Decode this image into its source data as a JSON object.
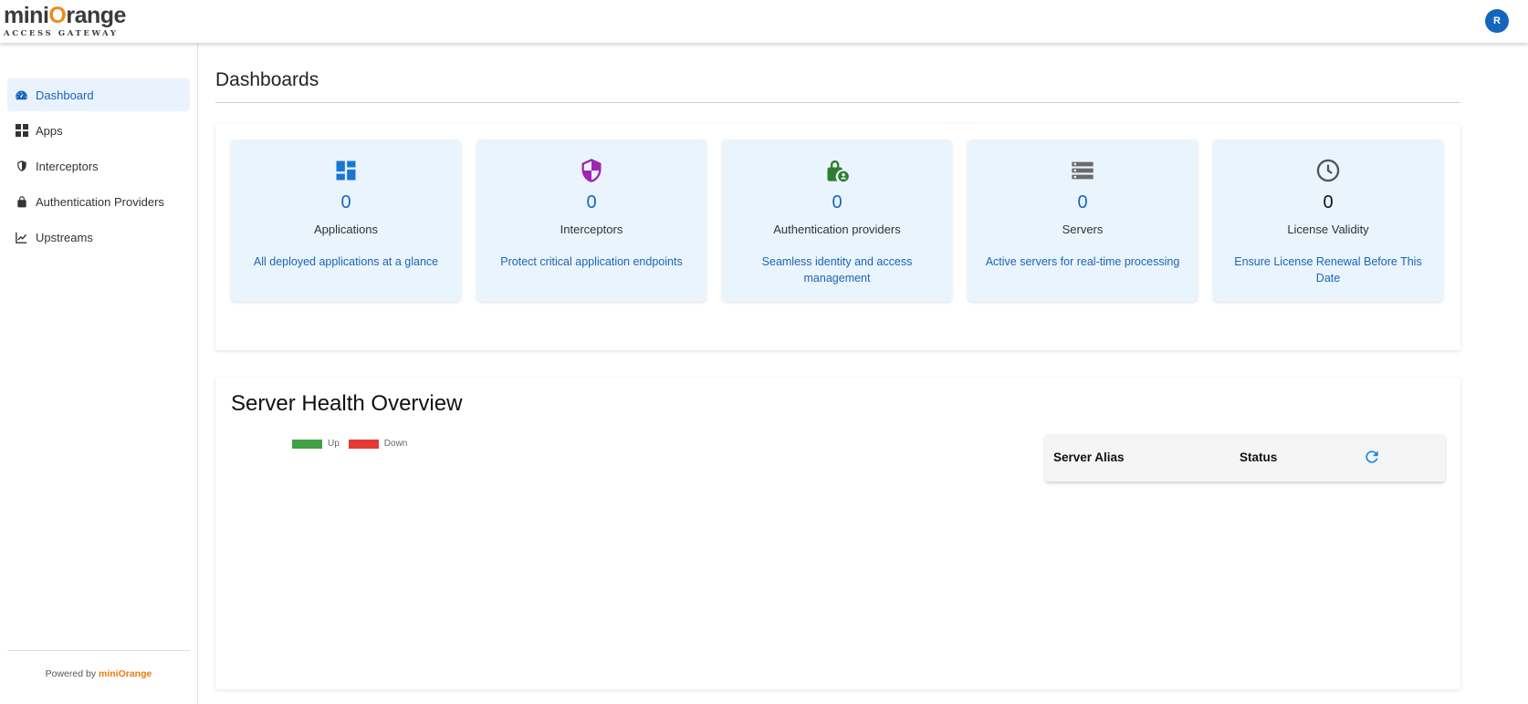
{
  "header": {
    "logo_text_left": "mini",
    "logo_text_o": "O",
    "logo_text_right": "range",
    "logo_subtitle": "ACCESS GATEWAY",
    "avatar_initial": "R"
  },
  "sidebar": {
    "items": [
      {
        "label": "Dashboard",
        "icon": "speedometer-icon",
        "active": true
      },
      {
        "label": "Apps",
        "icon": "grid-icon"
      },
      {
        "label": "Interceptors",
        "icon": "shield-icon"
      },
      {
        "label": "Authentication Providers",
        "icon": "lock-icon"
      },
      {
        "label": "Upstreams",
        "icon": "trending-up-icon"
      }
    ],
    "powered_by": "Powered by",
    "powered_brand": "miniOrange"
  },
  "main": {
    "title": "Dashboards",
    "cards": [
      {
        "value": "0",
        "name": "Applications",
        "description": "All deployed applications at a glance",
        "icon": "dashboard-tiles-icon",
        "icon_color": "#1976d2"
      },
      {
        "value": "0",
        "name": "Interceptors",
        "description": "Protect critical application endpoints",
        "icon": "shield-half-icon",
        "icon_color": "#9c27b0"
      },
      {
        "value": "0",
        "name": "Authentication providers",
        "description": "Seamless identity and access management",
        "icon": "lock-person-icon",
        "icon_color": "#2e7d32"
      },
      {
        "value": "0",
        "name": "Servers",
        "description": "Active servers for real-time processing",
        "icon": "server-stack-icon",
        "icon_color": "#6b6b6b"
      },
      {
        "value": "0",
        "name": "License Validity",
        "description": "Ensure License Renewal Before This Date",
        "icon": "clock-icon",
        "icon_color": "#555555"
      }
    ],
    "health": {
      "title": "Server Health Overview",
      "legend": [
        {
          "label": "Up",
          "color": "#43a047"
        },
        {
          "label": "Down",
          "color": "#e53935"
        }
      ],
      "table": {
        "columns": [
          "Server Alias",
          "Status"
        ],
        "rows": [],
        "refresh_icon": "refresh-icon",
        "refresh_color": "#1e88e5"
      }
    }
  },
  "colors": {
    "accent": "#1565c0",
    "brand_orange": "#f07a10",
    "card_bg": "#eaf4fd"
  }
}
